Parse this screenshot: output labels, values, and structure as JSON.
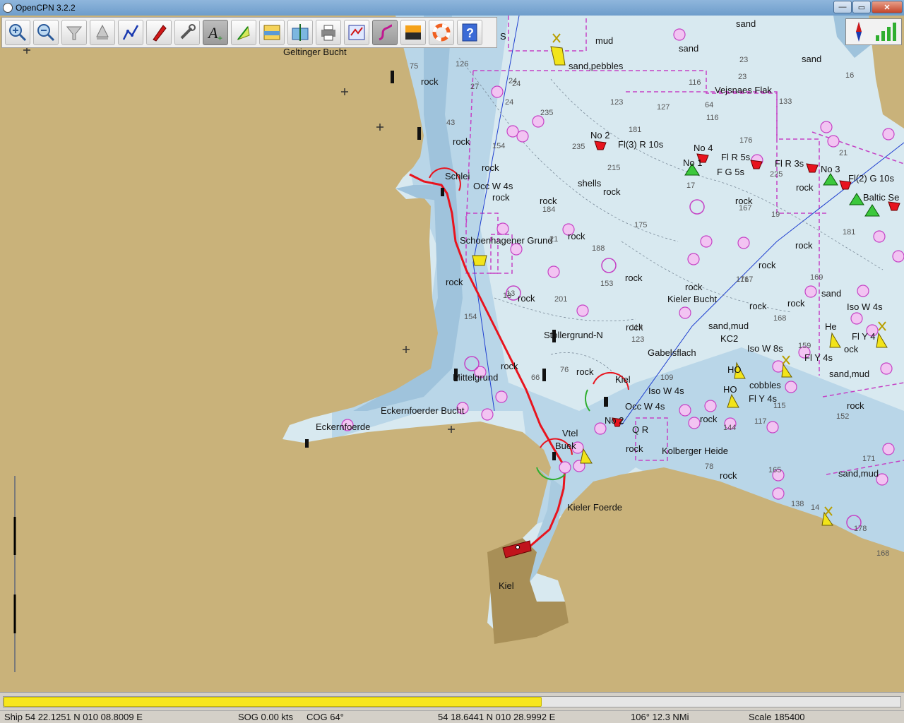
{
  "window": {
    "title": "OpenCPN 3.2.2",
    "minimize_glyph": "—",
    "maximize_glyph": "▭",
    "close_glyph": "✕"
  },
  "toolbar": {
    "buttons": [
      {
        "name": "zoom-in-button",
        "icon": "zoom-in-icon"
      },
      {
        "name": "zoom-out-button",
        "icon": "zoom-out-icon"
      },
      {
        "name": "scale-in-button",
        "icon": "scale-in-icon"
      },
      {
        "name": "scale-out-button",
        "icon": "scale-out-icon"
      },
      {
        "name": "route-button",
        "icon": "route-icon"
      },
      {
        "name": "follow-ship-button",
        "icon": "ship-icon"
      },
      {
        "name": "settings-button",
        "icon": "wrench-icon"
      },
      {
        "name": "text-toggle-button",
        "icon": "text-icon"
      },
      {
        "name": "current-button",
        "icon": "current-icon"
      },
      {
        "name": "tides-button",
        "icon": "tide-icon"
      },
      {
        "name": "cm93-button",
        "icon": "chart-icon"
      },
      {
        "name": "print-button",
        "icon": "printer-icon"
      },
      {
        "name": "route-manager-button",
        "icon": "route-manager-icon"
      },
      {
        "name": "track-button",
        "icon": "track-icon"
      },
      {
        "name": "color-scheme-button",
        "icon": "color-scheme-icon"
      },
      {
        "name": "mob-button",
        "icon": "lifebuoy-icon"
      },
      {
        "name": "help-button",
        "icon": "help-icon"
      }
    ],
    "help_glyph": "?"
  },
  "compass": {
    "icons": [
      "compass-icon",
      "gps-signal-icon"
    ]
  },
  "chart_labels": {
    "geltinger_bucht": "Geltinger Bucht",
    "schlei": "Schlei",
    "occ_w_4s": "Occ W 4s",
    "schoenhagener_grund": "Schoenhagener Grund",
    "eckernfoerder_bucht": "Eckernfoerder Bucht",
    "eckernfoerde": "Eckernfoerde",
    "mittelgrund": "Mittelgrund",
    "stollergrund_n": "Stollergrund-N",
    "kieler_bucht": "Kieler Bucht",
    "gabelsflach": "Gabelsflach",
    "kiel_light": "Kiel",
    "iso_w_4s": "Iso W 4s",
    "occ_w_4s_2": "Occ W 4s",
    "no_2_south": "No 2",
    "q_r": "Q R",
    "kolberger_heide": "Kolberger Heide",
    "kieler_foerde": "Kieler Foerde",
    "kiel_city": "Kiel",
    "vejsnaes_flak": "Vejsnaes Flak",
    "no_2_north": "No 2",
    "fl3_r_10s": "Fl(3) R 10s",
    "no_4": "No 4",
    "no_1": "No 1",
    "fl_r_5s": "Fl R 5s",
    "fl_r_3s": "Fl R 3s",
    "no_3": "No 3",
    "fl2_g_10s": "Fl(2) G 10s",
    "baltic_se": "Baltic Se",
    "f_g_5s": "F G 5s",
    "mud": "mud",
    "sand_pebbles": "sand,pebbles",
    "sand": "sand",
    "shells": "shells",
    "sand_mud": "sand,mud",
    "iso_w_8s": "Iso W 8s",
    "fl_y_4s": "Fl Y 4s",
    "cobbles": "cobbles",
    "kc2": "KC2",
    "sand_mud_2": "sand,mud",
    "sand_mud_3": "sand,mud",
    "iso_w_4s_2": "Iso W 4s",
    "fl_y_4": "Fl Y 4",
    "fl_y_4s_2": "Fl Y 4s",
    "rock": "rock",
    "s_top": "S",
    "he": "He",
    "ho": "HO",
    "lock": "ock",
    "vtmark": "Vtel",
    "buek": "Buek"
  },
  "depths": [
    "75",
    "126",
    "27",
    "24",
    "24",
    "235",
    "123",
    "127",
    "116",
    "23",
    "64",
    "133",
    "16",
    "43",
    "154",
    "181",
    "176",
    "21",
    "235",
    "215",
    "225",
    "17",
    "167",
    "19",
    "184",
    "175",
    "181",
    "21",
    "188",
    "153",
    "167",
    "169",
    "171",
    "13",
    "201",
    "114",
    "123",
    "154",
    "168",
    "159",
    "76",
    "66",
    "109",
    "117",
    "152",
    "144",
    "78",
    "165",
    "138",
    "178",
    "168",
    "171",
    "13",
    "14",
    "23",
    "116",
    "115",
    "24"
  ],
  "status": {
    "ship": "Ship 54 22.1251 N   010 08.8009 E",
    "sog": "SOG 0.00 kts",
    "cog": "COG 64°",
    "cursor": "54 18.6441 N   010 28.9992 E",
    "bearing": "106°  12.3 NMi",
    "scale": "Scale 185400"
  },
  "progress": {
    "fraction": 0.6
  },
  "colors": {
    "land": "#c9b27a",
    "shallow": "#a9cbe0",
    "deep": "#d8e9f0",
    "route": "#e8141e",
    "restricted": "#c542c5",
    "yellow_mark": "#f2e41a"
  }
}
